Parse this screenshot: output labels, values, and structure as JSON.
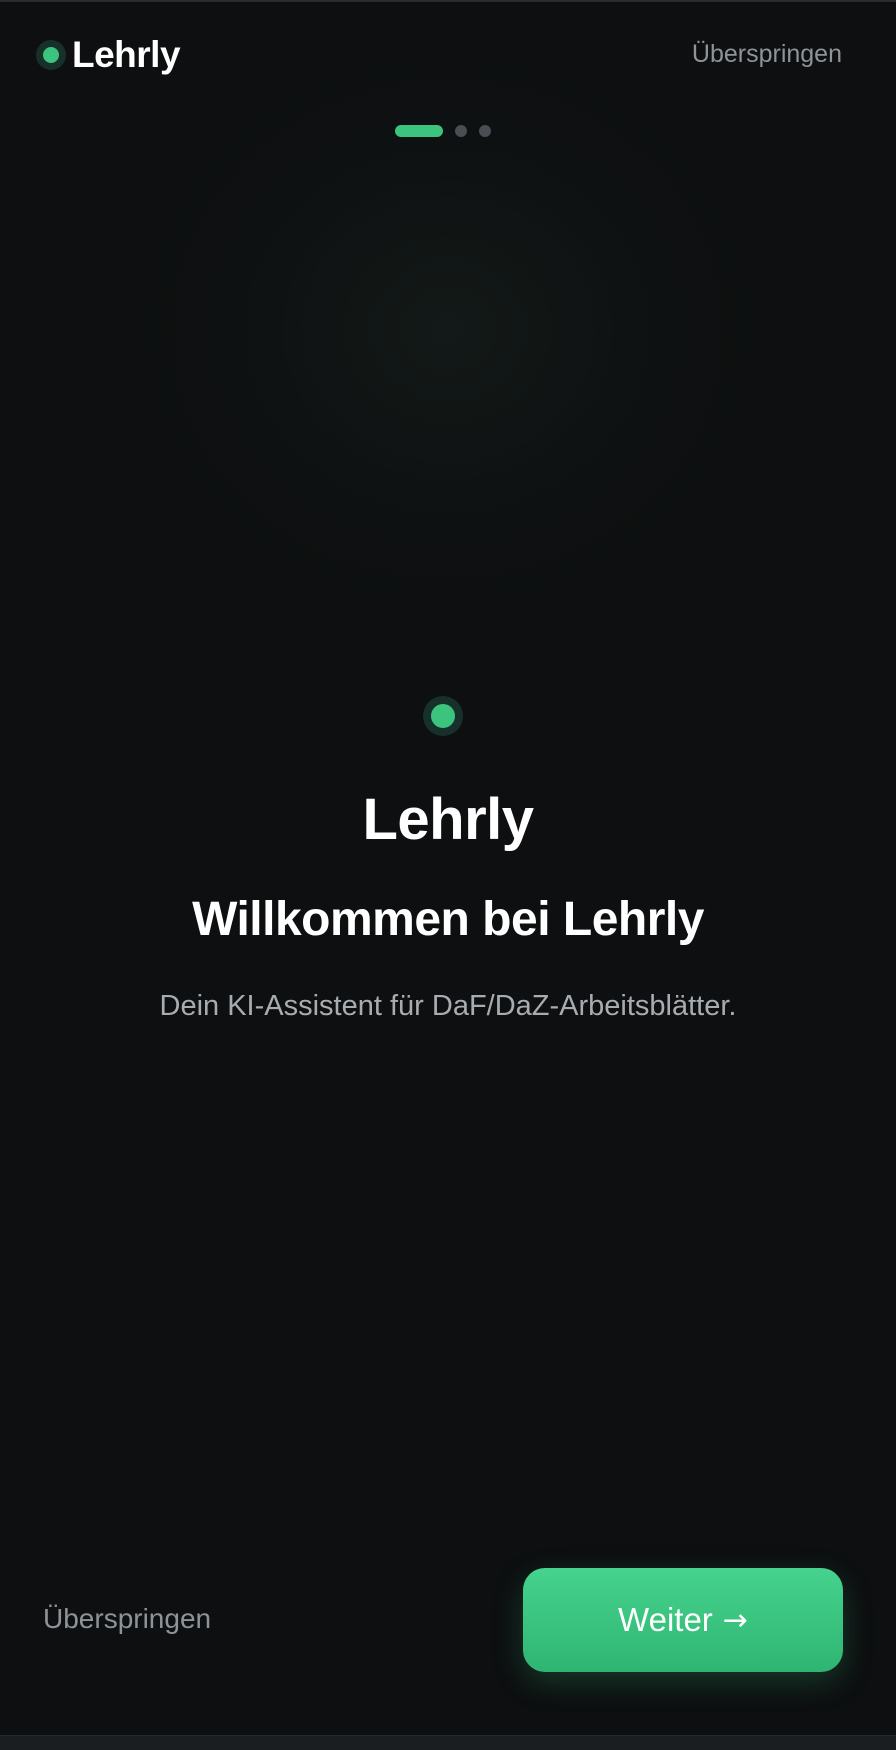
{
  "header": {
    "brand_name": "Lehrly",
    "skip_label": "Überspringen"
  },
  "pager": {
    "total": 3,
    "current": 1
  },
  "hero": {
    "icon": "app-logo-dot-icon",
    "title": "Lehrly",
    "welcome": "Willkommen bei Lehrly",
    "subtitle": "Dein KI-Assistent für DaF/DaZ-Arbeitsblätter."
  },
  "footer": {
    "skip_label": "Überspringen",
    "next_label": "Weiter",
    "next_icon": "→"
  },
  "colors": {
    "background": "#0d0f10",
    "accent": "#3cc47f",
    "muted_text": "#8e9399"
  }
}
